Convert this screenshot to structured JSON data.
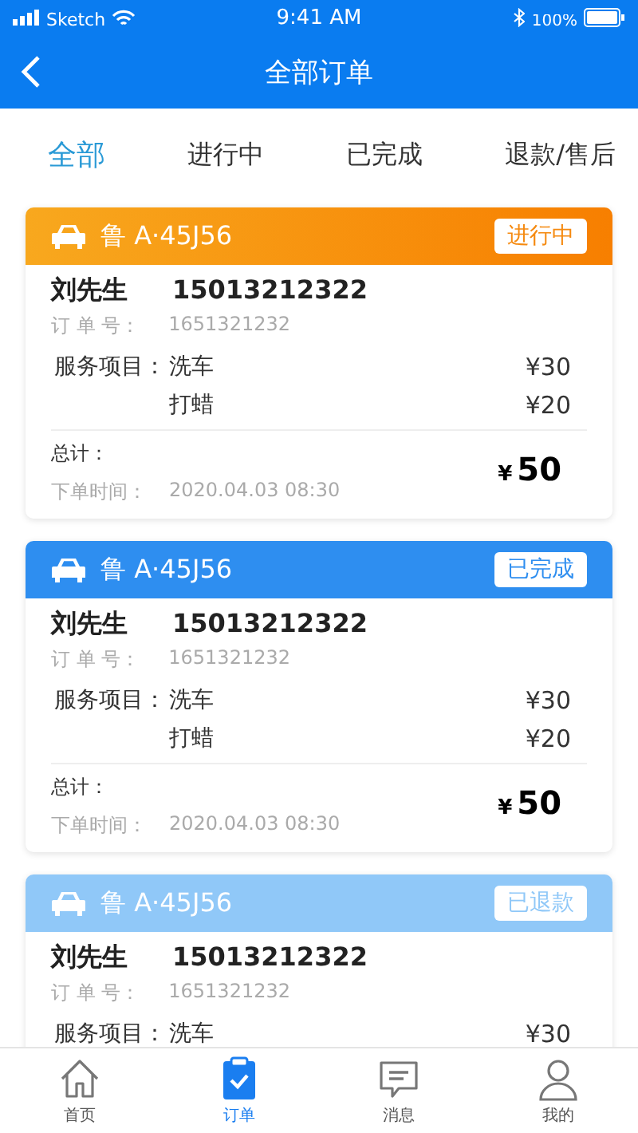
{
  "status_bar": {
    "carrier": "Sketch",
    "time": "9:41 AM",
    "battery": "100%"
  },
  "nav": {
    "title": "全部订单"
  },
  "tabs": [
    {
      "label": "全部",
      "selected": true
    },
    {
      "label": "进行中",
      "selected": false
    },
    {
      "label": "已完成",
      "selected": false
    },
    {
      "label": "退款/售后",
      "selected": false
    }
  ],
  "orders": [
    {
      "kind": "in_progress",
      "plate": "鲁 A·45J56",
      "status": "进行中",
      "customer": "刘先生",
      "phone": "15013212322",
      "order_no_label": "订 单 号：",
      "order_no": "1651321232",
      "services_label": "服务项目：",
      "services": [
        {
          "name": "洗车",
          "price": "¥30"
        },
        {
          "name": "打蜡",
          "price": "¥20"
        }
      ],
      "total_label": "总计：",
      "total_currency": "¥",
      "total": "50",
      "time_label": "下单时间：",
      "time": "2020.04.03  08:30"
    },
    {
      "kind": "completed",
      "plate": "鲁 A·45J56",
      "status": "已完成",
      "customer": "刘先生",
      "phone": "15013212322",
      "order_no_label": "订 单 号：",
      "order_no": "1651321232",
      "services_label": "服务项目：",
      "services": [
        {
          "name": "洗车",
          "price": "¥30"
        },
        {
          "name": "打蜡",
          "price": "¥20"
        }
      ],
      "total_label": "总计：",
      "total_currency": "¥",
      "total": "50",
      "time_label": "下单时间：",
      "time": "2020.04.03  08:30"
    },
    {
      "kind": "refunded",
      "plate": "鲁 A·45J56",
      "status": "已退款",
      "customer": "刘先生",
      "phone": "15013212322",
      "order_no_label": "订 单 号：",
      "order_no": "1651321232",
      "services_label": "服务项目：",
      "services": [
        {
          "name": "洗车",
          "price": "¥30"
        }
      ]
    }
  ],
  "tab_bar": [
    {
      "kind": "home",
      "label": "首页",
      "selected": false
    },
    {
      "kind": "orders",
      "label": "订单",
      "selected": true
    },
    {
      "kind": "messages",
      "label": "消息",
      "selected": false
    },
    {
      "kind": "profile",
      "label": "我的",
      "selected": false
    }
  ]
}
